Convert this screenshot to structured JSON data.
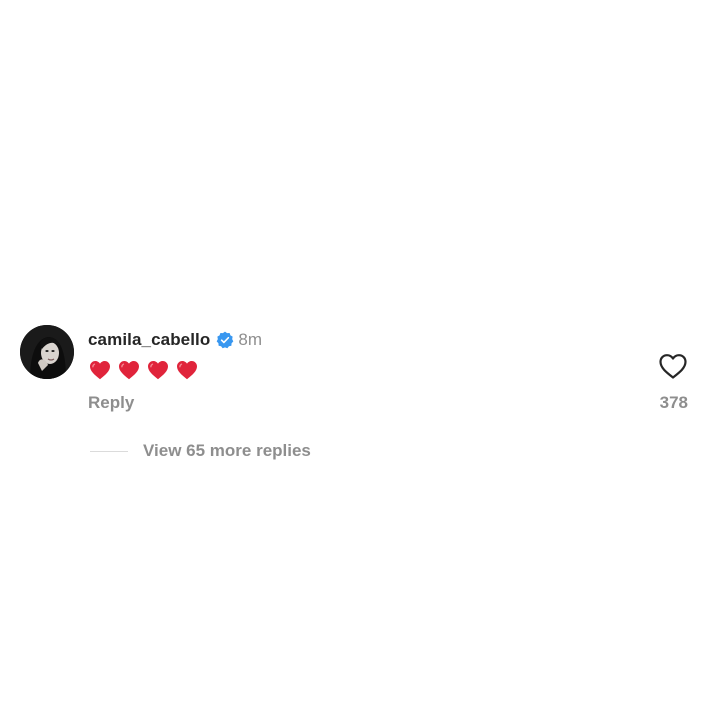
{
  "comment": {
    "username": "camila_cabello",
    "verified": true,
    "timestamp": "8m",
    "text_emoji": [
      "❤️",
      "❤️",
      "❤️",
      "❤️"
    ],
    "reply_label": "Reply",
    "like_count": "378",
    "view_replies_label": "View 65 more replies"
  },
  "icons": {
    "avatar": "avatar",
    "verified": "verified-badge-icon",
    "heart_emoji": "red-heart-emoji",
    "like": "heart-outline-icon"
  },
  "colors": {
    "text_primary": "#262626",
    "text_secondary": "#8e8e8e",
    "verified_blue": "#3897f0",
    "heart_red": "#e0243b",
    "divider": "#dbdbdb"
  }
}
